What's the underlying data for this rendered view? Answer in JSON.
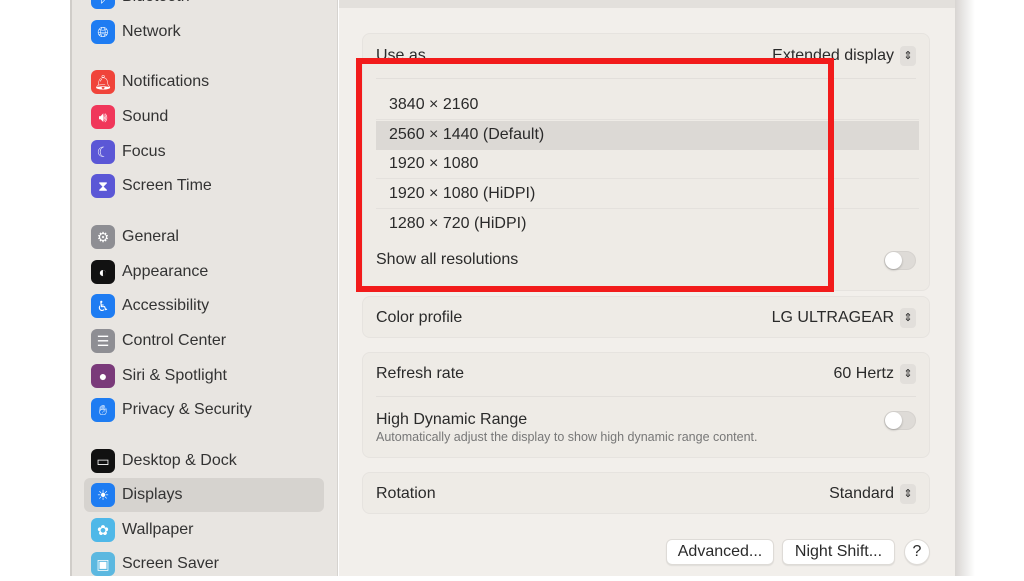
{
  "sidebar": {
    "items": [
      {
        "label": "Bluetooth",
        "icon": "bluetooth-icon",
        "color": "#1e7cf2"
      },
      {
        "label": "Network",
        "icon": "globe-icon",
        "color": "#1e7cf2"
      },
      {
        "label": "Notifications",
        "icon": "bell-icon",
        "color": "#f0443a"
      },
      {
        "label": "Sound",
        "icon": "speaker-icon",
        "color": "#f0375a"
      },
      {
        "label": "Focus",
        "icon": "moon-icon",
        "color": "#5b57d6"
      },
      {
        "label": "Screen Time",
        "icon": "hourglass-icon",
        "color": "#5b57d6"
      },
      {
        "label": "General",
        "icon": "gear-icon",
        "color": "#8e8e93"
      },
      {
        "label": "Appearance",
        "icon": "appearance-icon",
        "color": "#111111"
      },
      {
        "label": "Accessibility",
        "icon": "accessibility-icon",
        "color": "#1e7cf2"
      },
      {
        "label": "Control Center",
        "icon": "toggles-icon",
        "color": "#8e8e93"
      },
      {
        "label": "Siri & Spotlight",
        "icon": "siri-icon",
        "color": "#7a3a7a"
      },
      {
        "label": "Privacy & Security",
        "icon": "hand-icon",
        "color": "#1e7cf2"
      },
      {
        "label": "Desktop & Dock",
        "icon": "dock-icon",
        "color": "#111111"
      },
      {
        "label": "Displays",
        "icon": "sun-icon",
        "color": "#1e7cf2",
        "selected": true
      },
      {
        "label": "Wallpaper",
        "icon": "flower-icon",
        "color": "#4fb8e8"
      },
      {
        "label": "Screen Saver",
        "icon": "screensaver-icon",
        "color": "#5cb8e0"
      }
    ]
  },
  "main": {
    "use_as": {
      "label": "Use as",
      "value": "Extended display"
    },
    "resolutions": [
      "3840 × 2160",
      "2560 × 1440 (Default)",
      "1920 × 1080",
      "1920 × 1080 (HiDPI)",
      "1280 × 720 (HiDPI)"
    ],
    "selected_resolution": "2560 × 1440 (Default)",
    "show_all": {
      "label": "Show all resolutions",
      "on": false
    },
    "color_profile": {
      "label": "Color profile",
      "value": "LG ULTRAGEAR"
    },
    "refresh_rate": {
      "label": "Refresh rate",
      "value": "60 Hertz"
    },
    "hdr": {
      "label": "High Dynamic Range",
      "description": "Automatically adjust the display to show high dynamic range content.",
      "on": false
    },
    "rotation": {
      "label": "Rotation",
      "value": "Standard"
    },
    "buttons": {
      "advanced": "Advanced...",
      "night_shift": "Night Shift...",
      "help": "?"
    },
    "stepper_glyph": "⌃⌄"
  },
  "annotation": {
    "highlight_color": "#f21b1b"
  }
}
